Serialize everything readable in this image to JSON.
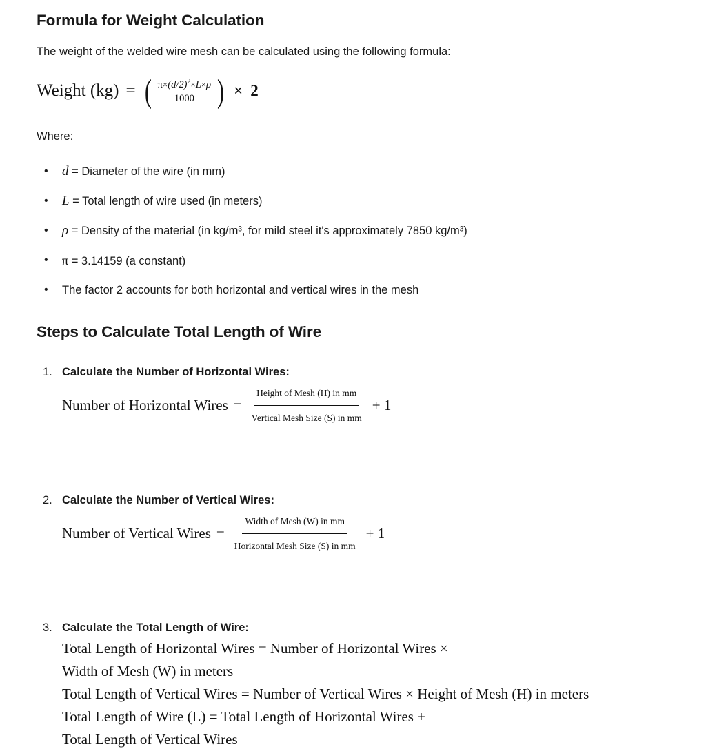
{
  "document": {
    "background_color": "#ffffff",
    "text_color": "#1a1a1a",
    "math_color": "#111111"
  },
  "section_weight": {
    "heading": "Formula for Weight Calculation",
    "intro": "The weight of the welded wire mesh can be calculated using the following formula:",
    "formula": {
      "lhs": "Weight (kg)",
      "equals": "=",
      "open_paren": "(",
      "numerator": {
        "pi": "π",
        "times1": "×",
        "d_expr": "(d/2)",
        "exponent": "2",
        "times2": "×",
        "L": "L",
        "times3": "×",
        "rho": "ρ"
      },
      "denominator": "1000",
      "close_paren": ")",
      "multiply_symbol": "×",
      "factor": "2",
      "plain_text": "Weight (kg) = ( π×(d/2)²×L×ρ / 1000 ) × 2"
    },
    "where_label": "Where:",
    "where_items": [
      {
        "symbol": "d",
        "symbol_style": "italic-serif",
        "definition": "= Diameter of the wire (in mm)"
      },
      {
        "symbol": "L",
        "symbol_style": "italic-serif",
        "definition": "= Total length of wire used (in meters)"
      },
      {
        "symbol": "ρ",
        "symbol_style": "italic-serif",
        "definition": "= Density of the material (in kg/m³, for mild steel it's approximately 7850 kg/m³)"
      },
      {
        "symbol": "π",
        "symbol_style": "upright-serif",
        "definition": "= 3.14159 (a constant)"
      },
      {
        "symbol": "",
        "symbol_style": "none",
        "definition": "The factor 2 accounts for both horizontal and vertical wires in the mesh"
      }
    ],
    "bullet_glyph": "•"
  },
  "section_steps": {
    "heading": "Steps to Calculate Total Length of Wire",
    "items": [
      {
        "marker": "1.",
        "title": "Calculate the Number of Horizontal Wires:",
        "equation": {
          "lhs": "Number of Horizontal Wires",
          "equals": "=",
          "numerator": "Height of Mesh (H) in mm",
          "denominator": "Vertical Mesh Size (S) in mm",
          "tail": "+ 1",
          "plain_text": "Number of Horizontal Wires = Height of Mesh (H) in mm / Vertical Mesh Size (S) in mm + 1"
        }
      },
      {
        "marker": "2.",
        "title": "Calculate the Number of Vertical Wires:",
        "equation": {
          "lhs": "Number of Vertical Wires",
          "equals": "=",
          "numerator": "Width of Mesh (W) in mm",
          "denominator": "Horizontal Mesh Size (S) in mm",
          "tail": "+ 1",
          "plain_text": "Number of Vertical Wires = Width of Mesh (W) in mm / Horizontal Mesh Size (S) in mm + 1"
        }
      },
      {
        "marker": "3.",
        "title": "Calculate the Total Length of Wire:",
        "equation_lines": [
          "Total Length of Horizontal Wires = Number of Horizontal Wires ×",
          "Width of Mesh (W) in meters",
          "Total Length of Vertical Wires = Number of Vertical Wires × Height of Mesh (H) in meters",
          "Total Length of Wire (L) = Total Length of Horizontal Wires +",
          "Total Length of Vertical Wires"
        ]
      }
    ]
  }
}
